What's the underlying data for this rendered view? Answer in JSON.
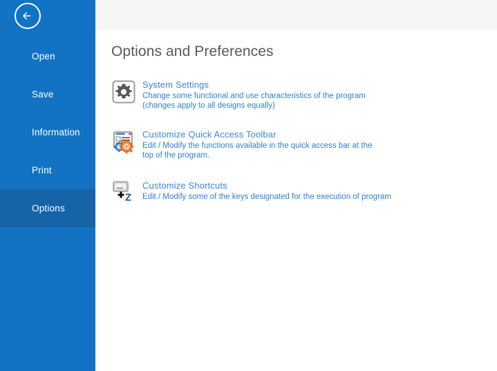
{
  "window": {
    "back_button_icon": "back-arrow-icon"
  },
  "sidebar": {
    "background_color": "#1273c4",
    "selected_color": "#1663a8",
    "items": [
      {
        "label": "Open",
        "selected": false
      },
      {
        "label": "Save",
        "selected": false
      },
      {
        "label": "Information",
        "selected": false
      },
      {
        "label": "Print",
        "selected": false
      },
      {
        "label": "Options",
        "selected": true
      }
    ]
  },
  "main": {
    "title": "Options and Preferences",
    "title_color": "#585858",
    "heading_color": "#3b86d4",
    "description_color": "#2f80d8",
    "options": [
      {
        "icon": "gear-icon",
        "heading": "System Settings",
        "description": "Change some functional and use characteristics of the program (changes apply to all designs equally)"
      },
      {
        "icon": "quick-access-toolbar-icon",
        "heading": "Customize Quick Access Toolbar",
        "description": "Edit / Modify the functions available in the quick access bar at the top of the program."
      },
      {
        "icon": "keyboard-shortcut-icon",
        "heading": "Customize Shortcuts",
        "description": "Edit / Modify some of the keys designated for the execution of program"
      }
    ]
  }
}
